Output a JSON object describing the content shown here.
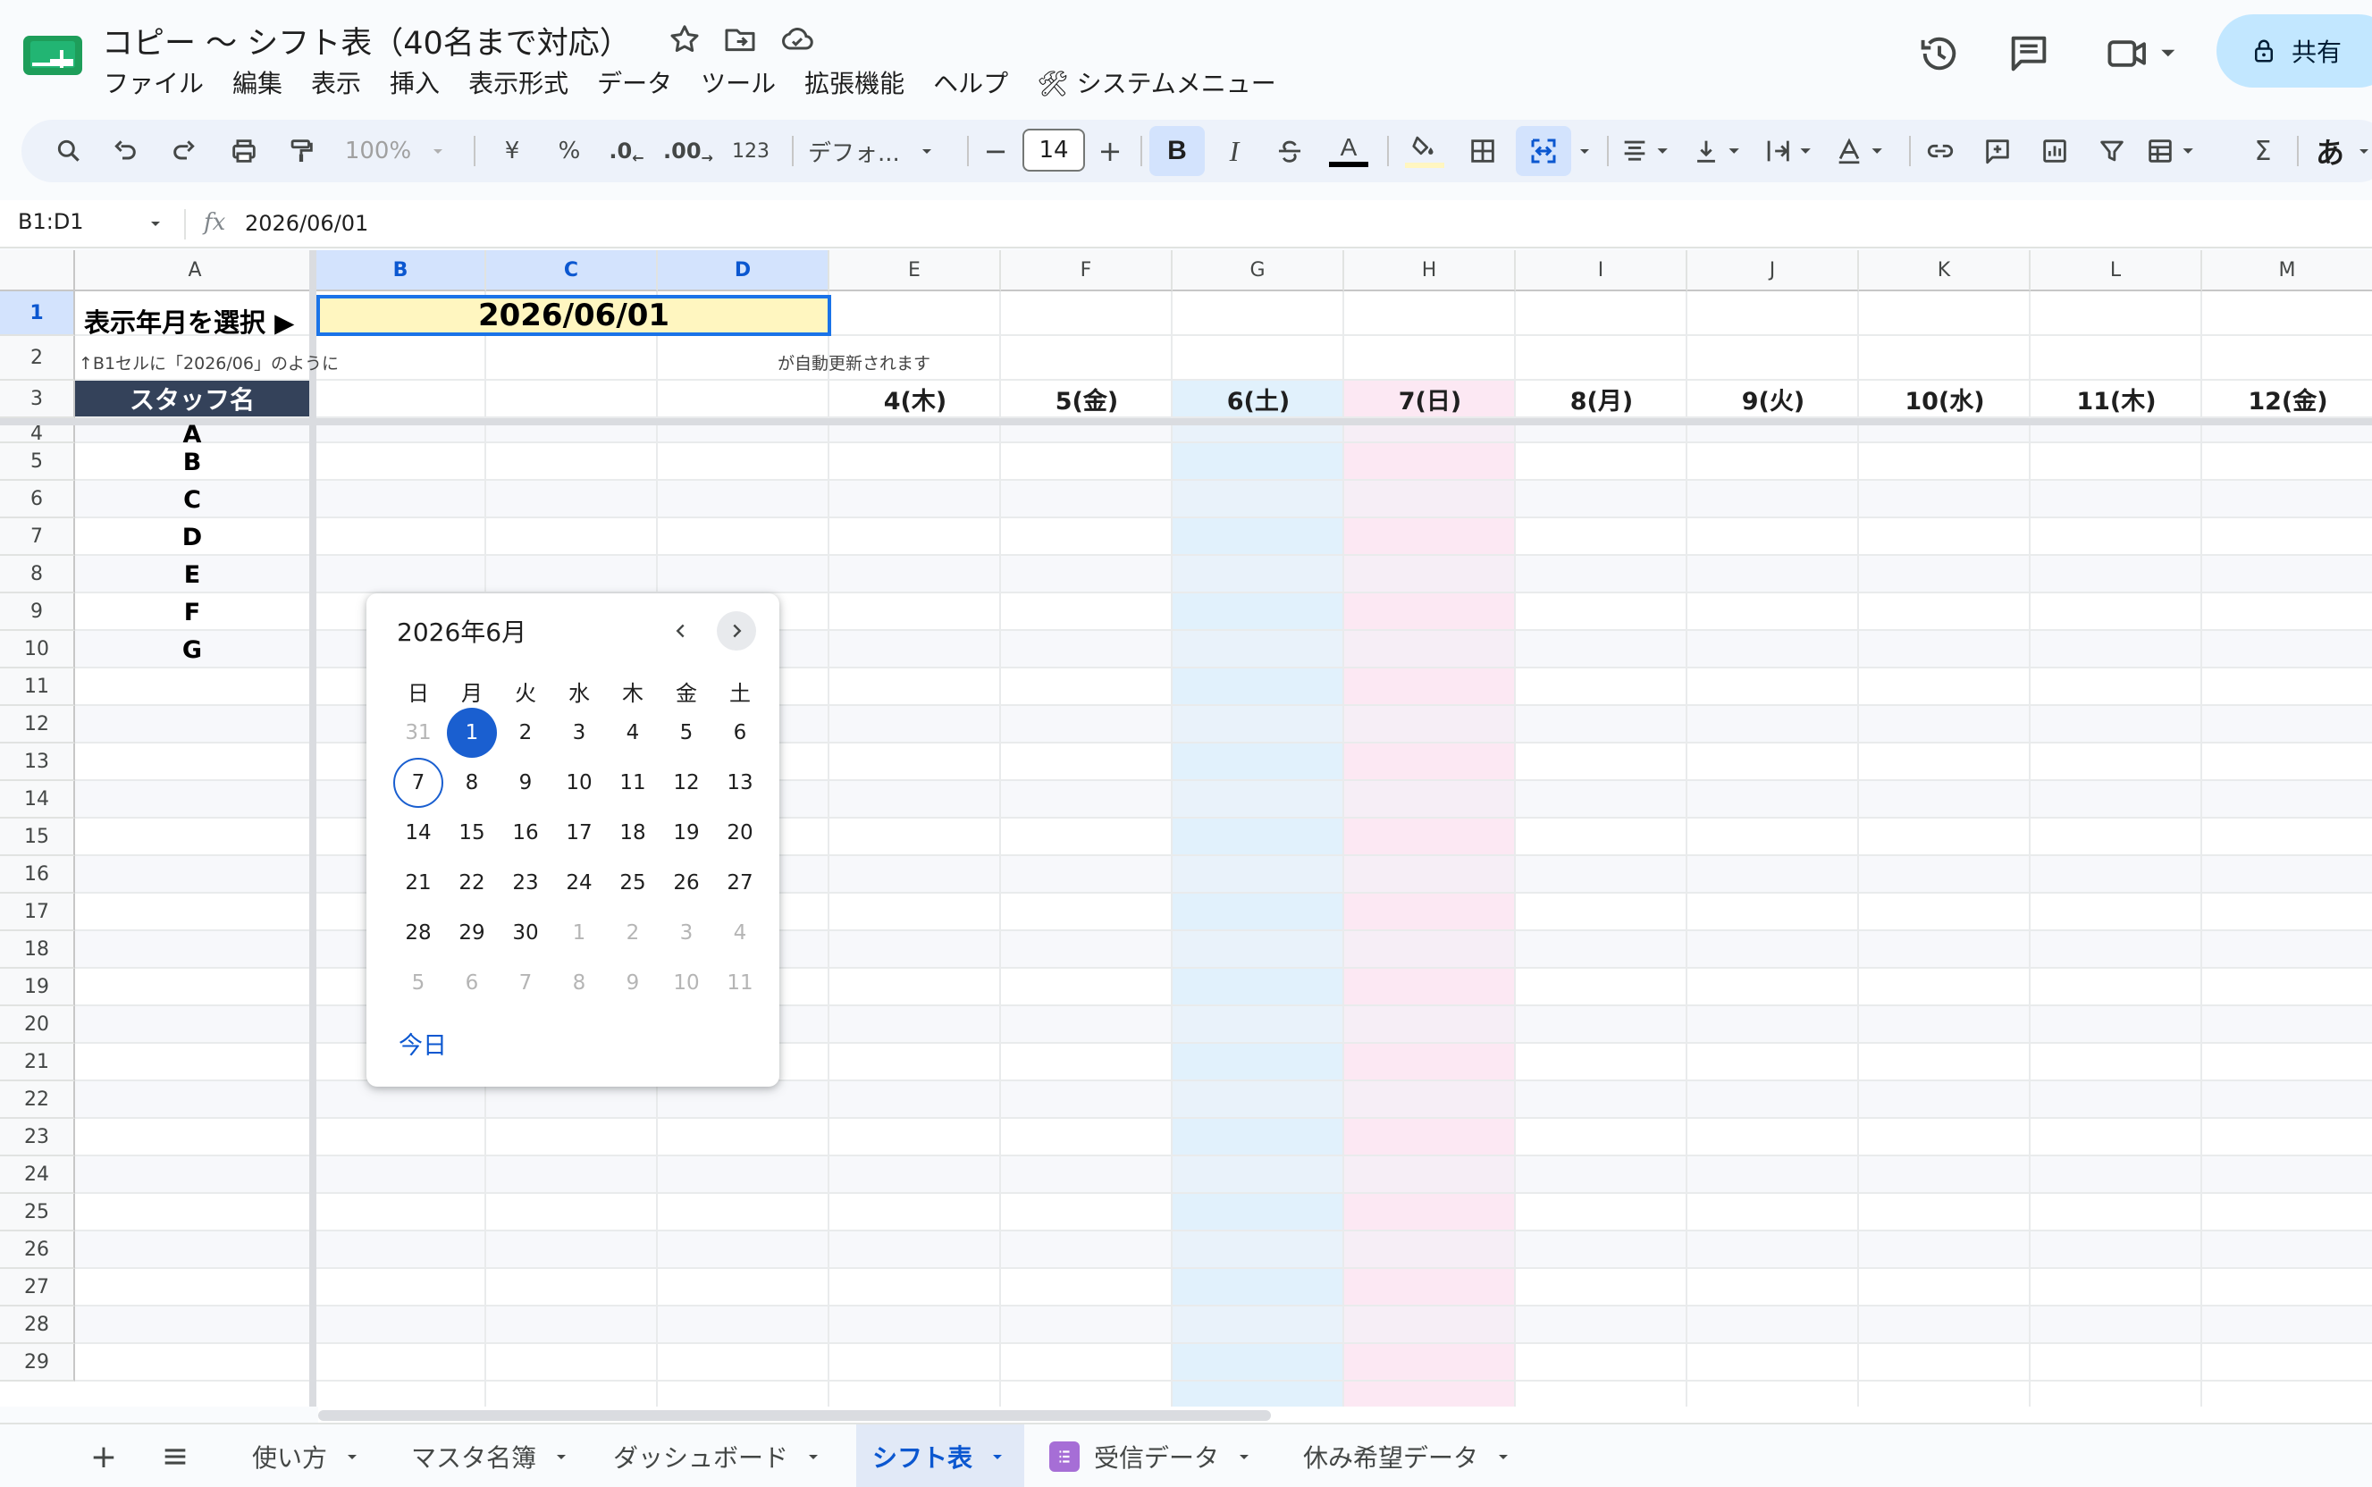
{
  "app": {
    "title": "コピー 〜 シフト表（40名まで対応）",
    "menus": [
      "ファイル",
      "編集",
      "表示",
      "挿入",
      "表示形式",
      "データ",
      "ツール",
      "拡張機能",
      "ヘルプ",
      "🛠 システムメニュー"
    ],
    "share_label": "共有"
  },
  "toolbar": {
    "zoom": "100%",
    "currency": "¥",
    "percent": "%",
    "decimal_decrease": ".0",
    "decimal_increase": ".00",
    "number_format": "123",
    "font": "デフォ...",
    "font_size": "14",
    "minus": "−",
    "plus": "+",
    "bold": "B",
    "italic": "I",
    "input_tool": "あ",
    "sum": "Σ"
  },
  "formula_bar": {
    "name_box": "B1:D1",
    "fx": "fx",
    "value": "2026/06/01"
  },
  "grid": {
    "columns": [
      "A",
      "B",
      "C",
      "D",
      "E",
      "F",
      "G",
      "H",
      "I",
      "J",
      "K",
      "L",
      "M"
    ],
    "rows": [
      "1",
      "2",
      "3",
      "4",
      "5",
      "6",
      "7",
      "8",
      "9",
      "10",
      "11",
      "12",
      "13",
      "14",
      "15",
      "16",
      "17",
      "18",
      "19",
      "20",
      "21",
      "22",
      "23",
      "24",
      "25",
      "26",
      "27",
      "28",
      "29"
    ],
    "a1_label": "表示年月を選択 ▶",
    "b1_value": "2026/06/01",
    "a2_note_start": "↑B1セルに「2026/06」のように",
    "a2_note_end": "が自動更新されます",
    "staff_header": "スタッフ名",
    "day_headers": [
      {
        "col": "E",
        "label": "4(木)"
      },
      {
        "col": "F",
        "label": "5(金)"
      },
      {
        "col": "G",
        "label": "6(土)"
      },
      {
        "col": "H",
        "label": "7(日)"
      },
      {
        "col": "I",
        "label": "8(月)"
      },
      {
        "col": "J",
        "label": "9(火)"
      },
      {
        "col": "K",
        "label": "10(水)"
      },
      {
        "col": "L",
        "label": "11(木)"
      },
      {
        "col": "M",
        "label": "12(金)"
      }
    ],
    "staff": [
      "A",
      "B",
      "C",
      "D",
      "E",
      "F",
      "G"
    ]
  },
  "datepicker": {
    "title": "2026年6月",
    "weekdays": [
      "日",
      "月",
      "火",
      "水",
      "木",
      "金",
      "土"
    ],
    "weeks": [
      [
        "31",
        "1",
        "2",
        "3",
        "4",
        "5",
        "6"
      ],
      [
        "7",
        "8",
        "9",
        "10",
        "11",
        "12",
        "13"
      ],
      [
        "14",
        "15",
        "16",
        "17",
        "18",
        "19",
        "20"
      ],
      [
        "21",
        "22",
        "23",
        "24",
        "25",
        "26",
        "27"
      ],
      [
        "28",
        "29",
        "30",
        "1",
        "2",
        "3",
        "4"
      ],
      [
        "5",
        "6",
        "7",
        "8",
        "9",
        "10",
        "11"
      ]
    ],
    "selected": "1",
    "today_marker": "7",
    "today_button": "今日"
  },
  "sheets": {
    "add": "+",
    "tabs": [
      {
        "label": "使い方",
        "active": false
      },
      {
        "label": "マスタ名簿",
        "active": false
      },
      {
        "label": "ダッシュボード",
        "active": false
      },
      {
        "label": "シフト表",
        "active": true
      },
      {
        "label": "受信データ",
        "active": false
      },
      {
        "label": "休み希望データ",
        "active": false
      }
    ]
  },
  "colors": {
    "selection": "#1a73e8",
    "b1_fill": "#fff6c0",
    "staff_header": "#34425a",
    "saturday": "#e1f1fc",
    "sunday": "#fce8f3",
    "share_button": "#c2e7ff"
  }
}
